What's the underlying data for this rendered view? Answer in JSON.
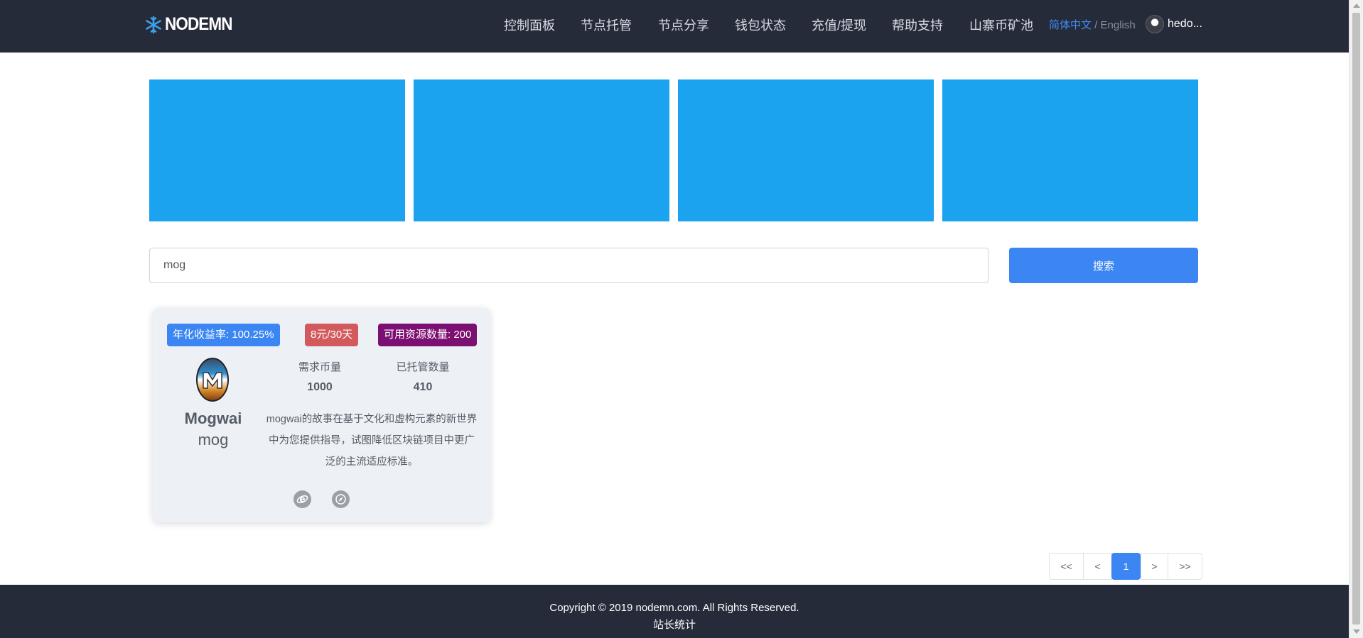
{
  "header": {
    "logo_text": "NODEMN",
    "nav": [
      {
        "label": "控制面板"
      },
      {
        "label": "节点托管"
      },
      {
        "label": "节点分享"
      },
      {
        "label": "钱包状态"
      },
      {
        "label": "充值/提现"
      },
      {
        "label": "帮助支持"
      },
      {
        "label": "山寨币矿池"
      }
    ],
    "lang_cn": "简体中文",
    "lang_sep": " / ",
    "lang_en": "English",
    "user_name": "hedo..."
  },
  "banners": [
    "",
    "",
    "",
    ""
  ],
  "search": {
    "value": "mog",
    "button_label": "搜索"
  },
  "card": {
    "badge_apy": "年化收益率: 100.25%",
    "badge_price": "8元/30天",
    "badge_resource": "可用资源数量: 200",
    "coin_name": "Mogwai",
    "coin_symbol": "mog",
    "required_label": "需求币量",
    "required_value": "1000",
    "hosted_label": "已托管数量",
    "hosted_value": "410",
    "description": "mogwai的故事在基于文化和虚构元素的新世界中为您提供指导，试图降低区块链项目中更广泛的主流适应标准。"
  },
  "pagination": {
    "first": "<<",
    "prev": "<",
    "current": "1",
    "next": ">",
    "last": ">>"
  },
  "footer": {
    "copyright": "Copyright © 2019 nodemn.com. All Rights Reserved.",
    "stats_link": "站长统计"
  },
  "colors": {
    "header_bg": "#262b3a",
    "banner": "#1ba3f0",
    "primary": "#3b86f2",
    "price_badge": "#d35a5c",
    "resource_badge": "#7c0f72"
  }
}
